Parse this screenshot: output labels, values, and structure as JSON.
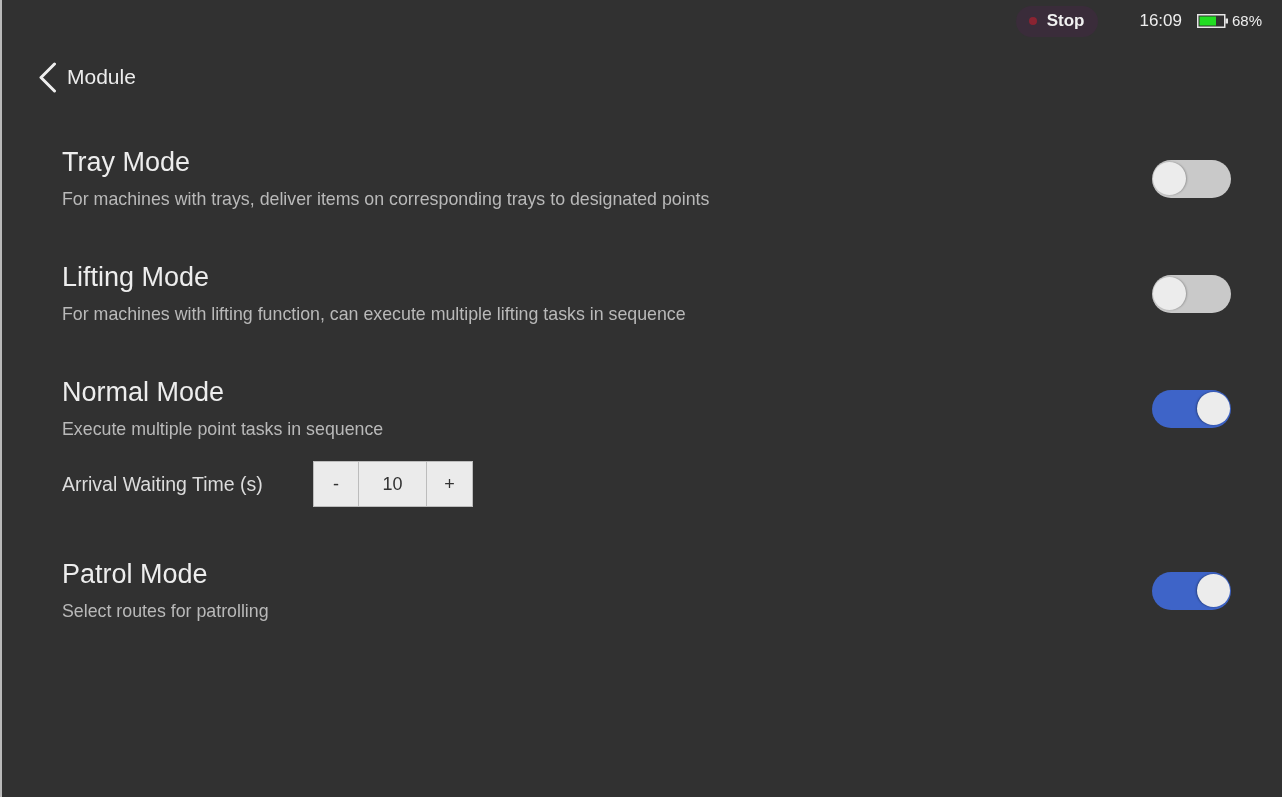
{
  "status_bar": {
    "stop_button": {
      "label": "Stop"
    },
    "time": "16:09",
    "battery_reading": "68%"
  },
  "header": {
    "title": "Module"
  },
  "modes": [
    {
      "title": "Tray Mode",
      "description": "For machines with trays, deliver items on corresponding trays to designated points",
      "on": false
    },
    {
      "title": "Lifting Mode",
      "description": "For machines with lifting function, can execute multiple lifting tasks in sequence",
      "on": false
    },
    {
      "title": "Normal Mode",
      "description": "Execute multiple point tasks in sequence",
      "on": true,
      "setting": {
        "label": "Arrival Waiting Time (s)",
        "decrement": "-",
        "value": "10",
        "increment": "+"
      }
    },
    {
      "title": "Patrol Mode",
      "description": "Select routes for patrolling",
      "on": true
    }
  ]
}
